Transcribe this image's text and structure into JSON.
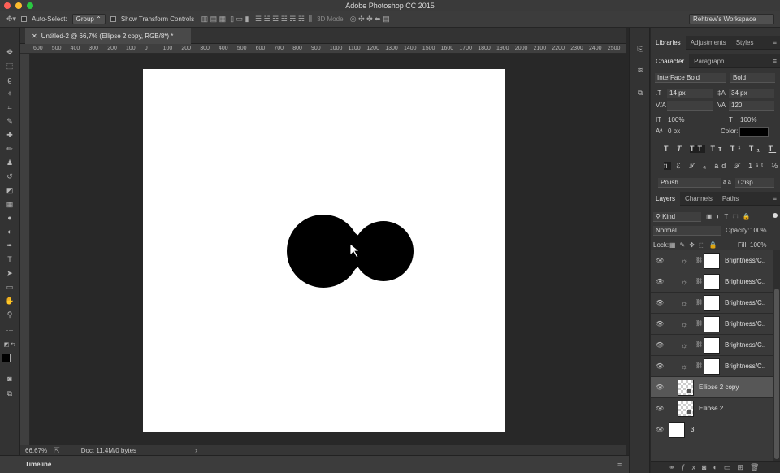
{
  "app": {
    "title": "Adobe Photoshop CC 2015"
  },
  "options": {
    "auto_select": "Auto-Select:",
    "group": "Group",
    "show_transform": "Show Transform Controls",
    "mode3d": "3D Mode:",
    "workspace": "Rehtrew's Workspace"
  },
  "document": {
    "tab": "Untitled-2 @ 66,7% (Ellipse 2 copy, RGB/8*) *"
  },
  "ruler": {
    "ticks": [
      "600",
      "500",
      "400",
      "300",
      "200",
      "100",
      "0",
      "100",
      "200",
      "300",
      "400",
      "500",
      "600",
      "700",
      "800",
      "900",
      "1000",
      "1100",
      "1200",
      "1300",
      "1400",
      "1500",
      "1600",
      "1700",
      "1800",
      "1900",
      "2000",
      "2100",
      "2200",
      "2300",
      "2400",
      "2500"
    ]
  },
  "status": {
    "zoom": "66,67%",
    "doc": "Doc: 11,4M/0 bytes"
  },
  "timeline": "Timeline",
  "panel_tabs": {
    "top": [
      "Libraries",
      "Adjustments",
      "Styles"
    ],
    "char": [
      "Character",
      "Paragraph"
    ],
    "layers": [
      "Layers",
      "Channels",
      "Paths"
    ]
  },
  "character": {
    "font": "InterFace Bold",
    "style": "Bold",
    "size": "14 px",
    "leading": "34 px",
    "kerning": "",
    "tracking": "120",
    "vscale": "100%",
    "hscale": "100%",
    "baseline": "0 px",
    "color_label": "Color:",
    "language": "Polish",
    "aa_label": "a a",
    "aa": "Crisp",
    "aa_sample": "ﬁ"
  },
  "layers_opts": {
    "filter": "Kind",
    "blend": "Normal",
    "opacity_label": "Opacity:",
    "opacity": "100%",
    "lock_label": "Lock:",
    "fill_label": "Fill:",
    "fill": "100%"
  },
  "layers": [
    {
      "name": "Brightness/C..."
    },
    {
      "name": "Brightness/C..."
    },
    {
      "name": "Brightness/C..."
    },
    {
      "name": "Brightness/C..."
    },
    {
      "name": "Brightness/C..."
    },
    {
      "name": "Brightness/C..."
    },
    {
      "name": "Ellipse 2 copy"
    },
    {
      "name": "Ellipse 2"
    },
    {
      "name": "3"
    }
  ]
}
